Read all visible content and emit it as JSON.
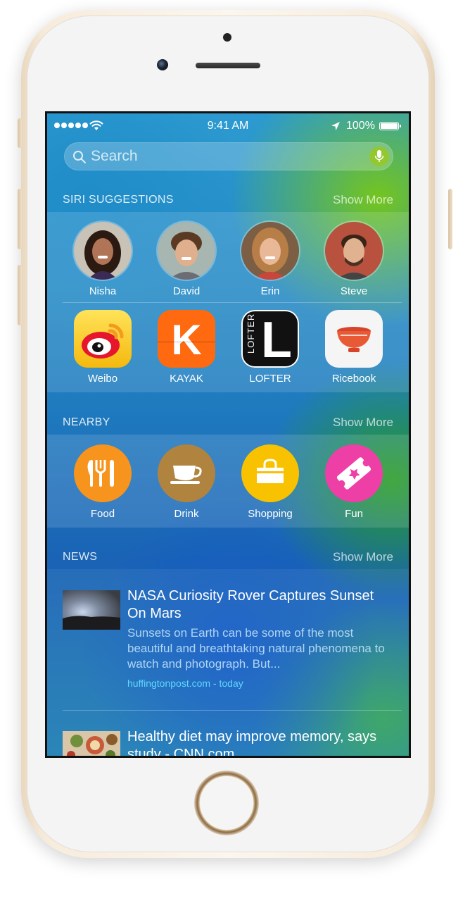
{
  "status_bar": {
    "time": "9:41 AM",
    "battery": "100%",
    "icons": [
      "signal-dots-icon",
      "wifi-icon",
      "location-arrow-icon",
      "battery-icon"
    ]
  },
  "search": {
    "placeholder": "Search",
    "icons": [
      "search-icon",
      "microphone-icon"
    ]
  },
  "siri_suggestions": {
    "title": "SIRI SUGGESTIONS",
    "show_more": "Show More",
    "contacts": [
      {
        "name": "Nisha"
      },
      {
        "name": "David"
      },
      {
        "name": "Erin"
      },
      {
        "name": "Steve"
      }
    ],
    "apps": [
      {
        "name": "Weibo",
        "icon": "weibo-app-icon"
      },
      {
        "name": "KAYAK",
        "icon": "kayak-app-icon",
        "glyph": "K"
      },
      {
        "name": "LOFTER",
        "icon": "lofter-app-icon",
        "glyph": "L",
        "side_text": "LOFTER"
      },
      {
        "name": "Ricebook",
        "icon": "ricebook-app-icon"
      }
    ]
  },
  "nearby": {
    "title": "NEARBY",
    "show_more": "Show More",
    "items": [
      {
        "name": "Food",
        "icon": "food-icon",
        "color": "#f7941d"
      },
      {
        "name": "Drink",
        "icon": "coffee-cup-icon",
        "color": "#b0833f"
      },
      {
        "name": "Shopping",
        "icon": "shopping-bag-icon",
        "color": "#f8c200"
      },
      {
        "name": "Fun",
        "icon": "ticket-icon",
        "color": "#ee3fa7"
      }
    ]
  },
  "news": {
    "title": "NEWS",
    "show_more": "Show More",
    "articles": [
      {
        "title": "NASA Curiosity Rover Captures Sunset On Mars",
        "snippet": "Sunsets on Earth can be some of the most beautiful and breathtaking natural phenomena to watch and photograph. But...",
        "source": "huffingtonpost.com - today"
      },
      {
        "title": "Healthy diet may improve memory, says study - CNN.com",
        "snippet": "",
        "source": ""
      }
    ]
  },
  "colors": {
    "accent_link": "#5fd8ff",
    "phone_gold": "#f7ecdc"
  }
}
